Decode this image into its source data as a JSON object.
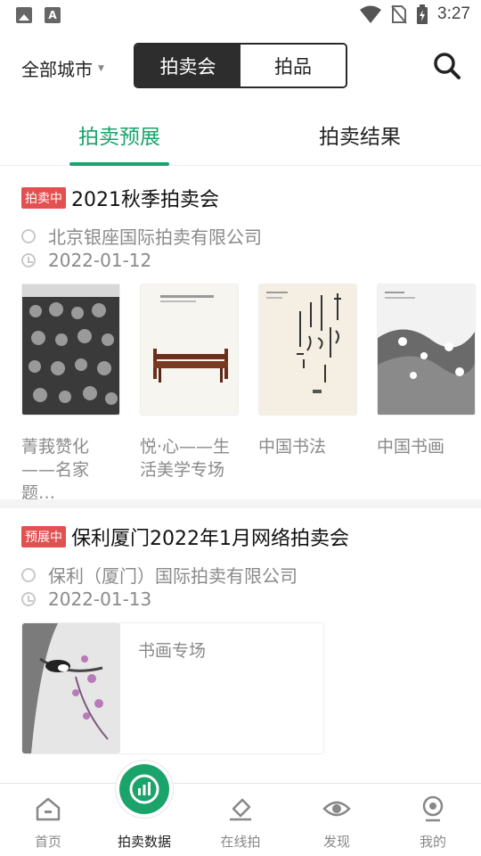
{
  "status_bar": {
    "time": "3:27",
    "left_icons": [
      "image-icon",
      "a-icon"
    ],
    "right_icons": [
      "wifi-icon",
      "no-sim-icon",
      "battery-icon"
    ]
  },
  "header": {
    "city_label": "全部城市",
    "segments": [
      {
        "label": "拍卖会",
        "active": true
      },
      {
        "label": "拍品",
        "active": false
      }
    ],
    "search_icon": "search-icon"
  },
  "tabs": [
    {
      "label": "拍卖预展",
      "active": true
    },
    {
      "label": "拍卖结果",
      "active": false
    }
  ],
  "auctions": [
    {
      "status": "拍卖中",
      "title": "2021秋季拍卖会",
      "company": "北京银座国际拍卖有限公司",
      "date": "2022-01-12",
      "lots": [
        {
          "name": "菁莪赞化——名家题…"
        },
        {
          "name": "悦·心——生活美学专场"
        },
        {
          "name": "中国书法"
        },
        {
          "name": "中国书画"
        }
      ]
    },
    {
      "status": "预展中",
      "title": "保利厦门2022年1月网络拍卖会",
      "company": "保利（厦门）国际拍卖有限公司",
      "date": "2022-01-13",
      "lots": [
        {
          "name": "书画专场"
        }
      ]
    }
  ],
  "bottom_nav": [
    {
      "label": "首页",
      "icon": "home-icon",
      "active": false
    },
    {
      "label": "拍卖数据",
      "icon": "chart-icon",
      "active": true
    },
    {
      "label": "在线拍",
      "icon": "gavel-icon",
      "active": false
    },
    {
      "label": "发现",
      "icon": "eye-icon",
      "active": false
    },
    {
      "label": "我的",
      "icon": "profile-icon",
      "active": false
    }
  ],
  "colors": {
    "accent": "#1aa36a",
    "badge": "#e25050",
    "segment_active": "#2d2d2d"
  }
}
